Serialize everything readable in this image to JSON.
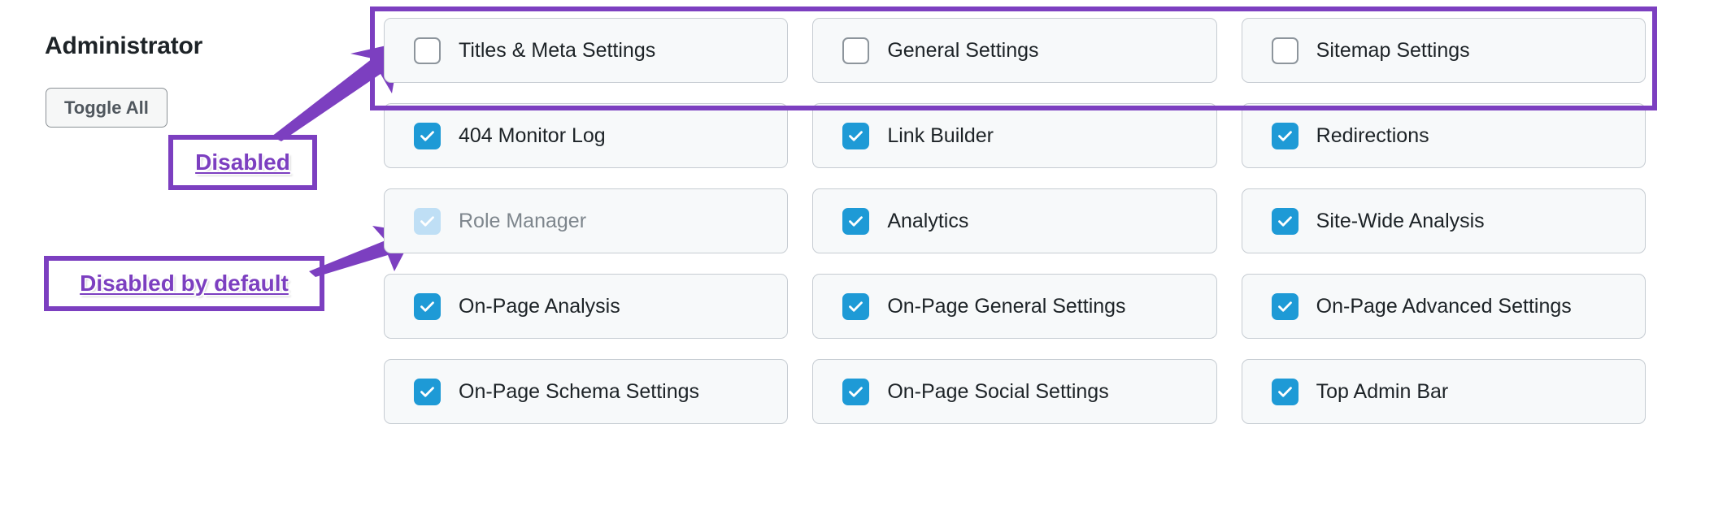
{
  "sidebar": {
    "role_title": "Administrator",
    "toggle_all_label": "Toggle All"
  },
  "annotations": [
    {
      "id": "disabled",
      "text": "Disabled",
      "color": "#7c3fc0",
      "points_to": "first-row-of-capabilities"
    },
    {
      "id": "disabled-by-default",
      "text": "Disabled by default",
      "color": "#7c3fc0",
      "points_to": "role-manager-capability"
    }
  ],
  "colors": {
    "annotation_purple": "#7c3fc0",
    "checkbox_checked_blue": "#1e9ad6",
    "checkbox_disabled_blue": "#bfdff5",
    "card_background": "#f7f9fa",
    "card_border": "#c6ccd2",
    "text_primary": "#1d2327",
    "text_muted": "#7e868d"
  },
  "grid": {
    "columns": 3,
    "rows": 5,
    "items": [
      {
        "label": "Titles & Meta Settings",
        "state": "unchecked"
      },
      {
        "label": "General Settings",
        "state": "unchecked"
      },
      {
        "label": "Sitemap Settings",
        "state": "unchecked"
      },
      {
        "label": "404 Monitor Log",
        "state": "checked"
      },
      {
        "label": "Link Builder",
        "state": "checked"
      },
      {
        "label": "Redirections",
        "state": "checked"
      },
      {
        "label": "Role Manager",
        "state": "disabled"
      },
      {
        "label": "Analytics",
        "state": "checked"
      },
      {
        "label": "Site-Wide Analysis",
        "state": "checked"
      },
      {
        "label": "On-Page Analysis",
        "state": "checked"
      },
      {
        "label": "On-Page General Settings",
        "state": "checked"
      },
      {
        "label": "On-Page Advanced Settings",
        "state": "checked"
      },
      {
        "label": "On-Page Schema Settings",
        "state": "checked"
      },
      {
        "label": "On-Page Social Settings",
        "state": "checked"
      },
      {
        "label": "Top Admin Bar",
        "state": "checked"
      }
    ]
  }
}
